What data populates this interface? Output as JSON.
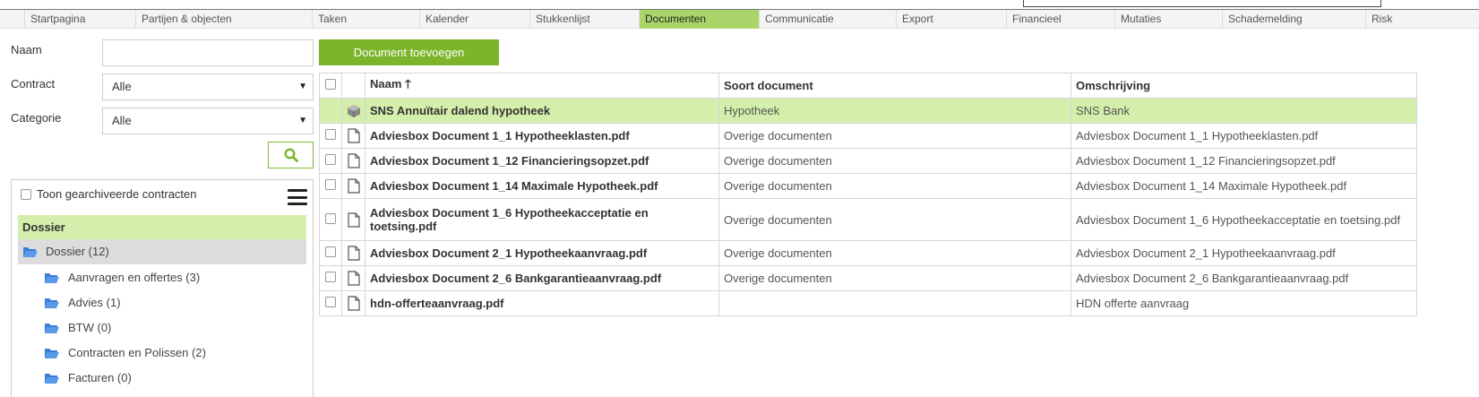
{
  "nav": {
    "tabs": [
      {
        "label": "Startpagina",
        "active": false
      },
      {
        "label": "Partijen & objecten",
        "active": false
      },
      {
        "label": "Taken",
        "active": false
      },
      {
        "label": "Kalender",
        "active": false
      },
      {
        "label": "Stukkenlijst",
        "active": false
      },
      {
        "label": "Documenten",
        "active": true
      },
      {
        "label": "Communicatie",
        "active": false
      },
      {
        "label": "Export",
        "active": false
      },
      {
        "label": "Financieel",
        "active": false
      },
      {
        "label": "Mutaties",
        "active": false
      },
      {
        "label": "Schademelding",
        "active": false
      },
      {
        "label": "Risk",
        "active": false
      }
    ]
  },
  "filters": {
    "naam_label": "Naam",
    "naam_value": "",
    "contract_label": "Contract",
    "contract_value": "Alle",
    "categorie_label": "Categorie",
    "categorie_value": "Alle"
  },
  "dossier": {
    "archive_label": "Toon gearchiveerde contracten",
    "header": "Dossier",
    "root": "Dossier (12)",
    "folders": [
      "Aanvragen en offertes (3)",
      "Advies (1)",
      "BTW (0)",
      "Contracten en Polissen (2)",
      "Facturen (0)"
    ]
  },
  "main": {
    "add_button": "Document toevoegen",
    "columns": {
      "name": "Naam",
      "sort_indicator": "🡑",
      "soort": "Soort document",
      "omschrijving": "Omschrijving"
    },
    "rows": [
      {
        "name": "SNS Annuïtair dalend hypotheek",
        "soort": "Hypotheek",
        "omschrijving": "SNS Bank",
        "icon": "package-icon",
        "highlight": true
      },
      {
        "name": "Adviesbox Document 1_1 Hypotheeklasten.pdf",
        "soort": "Overige documenten",
        "omschrijving": "Adviesbox Document 1_1 Hypotheeklasten.pdf",
        "icon": "file-icon",
        "highlight": false
      },
      {
        "name": "Adviesbox Document 1_12 Financieringsopzet.pdf",
        "soort": "Overige documenten",
        "omschrijving": "Adviesbox Document 1_12 Financieringsopzet.pdf",
        "icon": "file-icon",
        "highlight": false
      },
      {
        "name": "Adviesbox Document 1_14 Maximale Hypotheek.pdf",
        "soort": "Overige documenten",
        "omschrijving": "Adviesbox Document 1_14 Maximale Hypotheek.pdf",
        "icon": "file-icon",
        "highlight": false
      },
      {
        "name": "Adviesbox Document 1_6 Hypotheekacceptatie en toetsing.pdf",
        "soort": "Overige documenten",
        "omschrijving": "Adviesbox Document 1_6 Hypotheekacceptatie en toetsing.pdf",
        "icon": "file-icon",
        "highlight": false,
        "tall": true
      },
      {
        "name": "Adviesbox Document 2_1 Hypotheekaanvraag.pdf",
        "soort": "Overige documenten",
        "omschrijving": "Adviesbox Document 2_1 Hypotheekaanvraag.pdf",
        "icon": "file-icon",
        "highlight": false
      },
      {
        "name": "Adviesbox Document 2_6 Bankgarantieaanvraag.pdf",
        "soort": "Overige documenten",
        "omschrijving": "Adviesbox Document 2_6 Bankgarantieaanvraag.pdf",
        "icon": "file-icon",
        "highlight": false
      },
      {
        "name": "hdn-offerteaanvraag.pdf",
        "soort": "",
        "omschrijving": "HDN offerte aanvraag",
        "icon": "file-icon",
        "highlight": false
      }
    ]
  },
  "colors": {
    "accent_green": "#7db52a",
    "highlight_green": "#d4efac",
    "active_tab": "#abd56a",
    "folder_blue": "#3b7fd6"
  }
}
